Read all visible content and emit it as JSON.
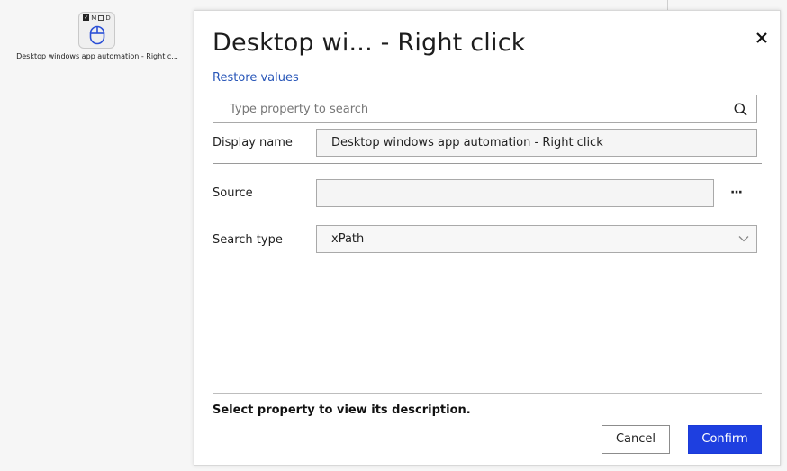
{
  "node": {
    "badges": [
      "M",
      "D"
    ],
    "label": "Desktop windows app automation - Right c..."
  },
  "dialog": {
    "title": "Desktop wi... - Right click",
    "restore_label": "Restore values",
    "search_placeholder": "Type property to search",
    "properties": {
      "display_name_label": "Display name",
      "display_name_value": "Desktop windows app automation - Right click",
      "source_label": "Source",
      "source_value": "",
      "source_browse": "···",
      "search_type_label": "Search type",
      "search_type_value": "xPath"
    },
    "description": "Select property to view its description.",
    "cancel_label": "Cancel",
    "confirm_label": "Confirm"
  },
  "colors": {
    "accent": "#1e3fe0",
    "link": "#2856b8"
  }
}
